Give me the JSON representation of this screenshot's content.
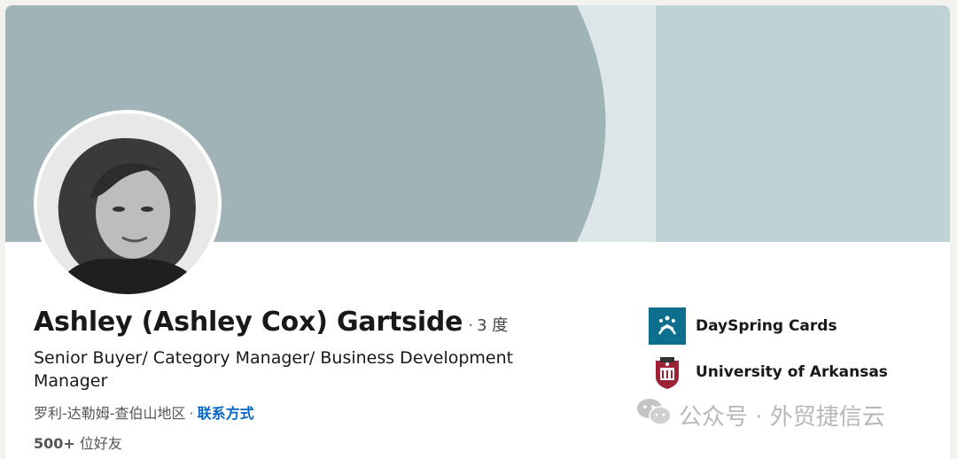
{
  "profile": {
    "name": "Ashley (Ashley Cox) Gartside",
    "degree_separator": "·",
    "degree": "3 度",
    "headline": "Senior Buyer/ Category Manager/ Business Development Manager",
    "location": "罗利-达勒姆-查伯山地区",
    "location_separator": "·",
    "contact_info_label": "联系方式",
    "connections_count": "500+",
    "connections_label": "位好友"
  },
  "organizations": [
    {
      "name": "DaySpring Cards",
      "logo_icon": "dayspring-logo-icon"
    },
    {
      "name": "University of Arkansas",
      "logo_icon": "university-of-arkansas-logo-icon"
    }
  ],
  "watermark": {
    "text": "公众号 · 外贸捷信云",
    "icon": "wechat-icon"
  },
  "colors": {
    "cover_dark": "#a0b3b6",
    "cover_mid": "#dde6e8",
    "cover_right": "#bfd2d6",
    "link": "#0a66c2",
    "dayspring_logo_bg": "#0d6e8e"
  }
}
